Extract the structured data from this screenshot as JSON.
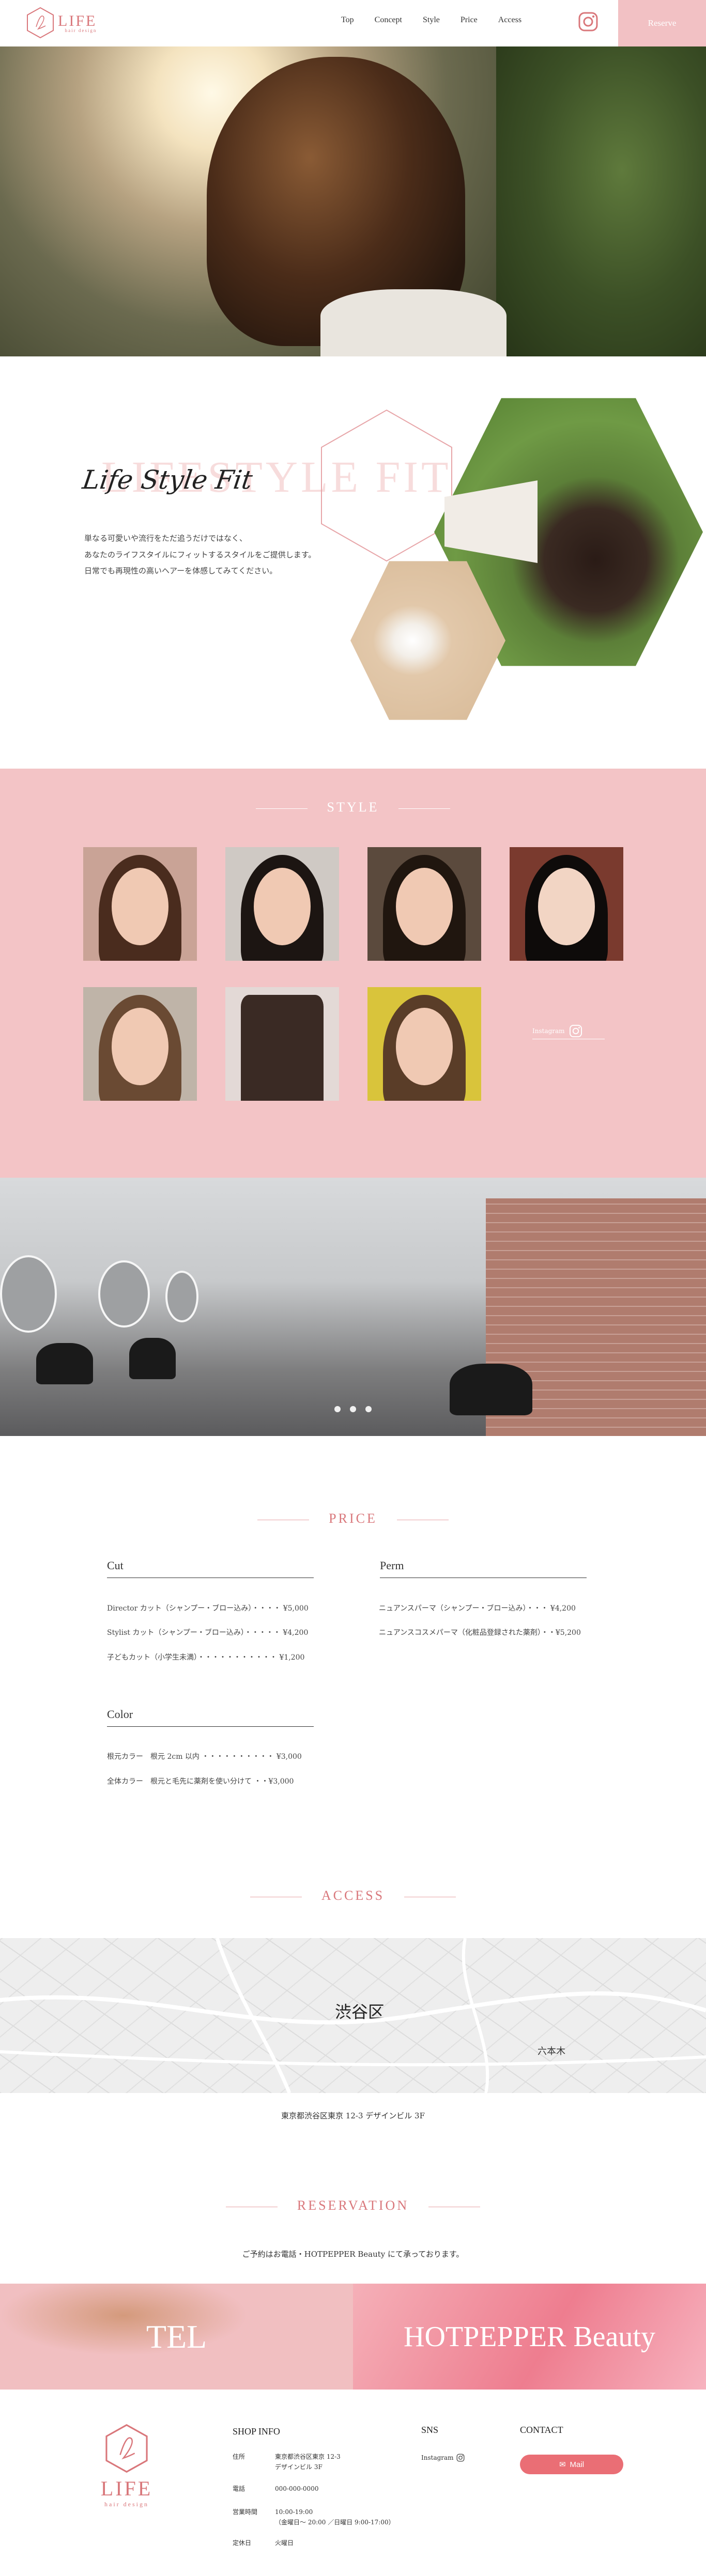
{
  "header": {
    "logo_text": "LIFE",
    "logo_sub": "hair design",
    "nav": [
      "Top",
      "Concept",
      "Style",
      "Price",
      "Access"
    ],
    "instagram_icon": "instagram-icon",
    "reserve_label": "Reserve"
  },
  "concept": {
    "bg_text": "LIFESTYLE FIT",
    "title": "Life Style Fit",
    "body": [
      "単なる可愛いや流行をただ追うだけではなく、",
      "あなたのライフスタイルにフィットするスタイルをご提供します。",
      "日常でも再現性の高いヘアーを体感してみてください。"
    ]
  },
  "style": {
    "title": "STYLE",
    "instagram_label": "Instagram"
  },
  "price": {
    "title": "PRICE",
    "categories": [
      {
        "name": "Cut",
        "rows": [
          "Director カット（シャンプー・ブロー込み）・・・・ ¥5,000",
          "Stylist カット（シャンプー・ブロー込み）・・・・・ ¥4,200",
          "子どもカット（小学生未満）・・・・・・・・・・・ ¥1,200"
        ]
      },
      {
        "name": "Perm",
        "rows": [
          "ニュアンスパーマ（シャンプー・ブロー込み）・・・ ¥4,200",
          "ニュアンスコスメパーマ（化粧品登録された薬剤）・・¥5,200"
        ]
      },
      {
        "name": "Color",
        "rows": [
          "根元カラー　根元 2cm 以内 ・・・・・・・・・・ ¥3,000",
          "全体カラー　根元と毛先に薬剤を使い分けて ・・¥3,000"
        ]
      }
    ]
  },
  "access": {
    "title": "ACCESS",
    "map_area": "渋谷区",
    "map_roppongi": "六本木",
    "address": "東京都渋谷区東京 12-3 デザインビル 3F"
  },
  "reservation": {
    "title": "RESERVATION",
    "note": "ご予約はお電話・HOTPEPPER Beauty にて承っております。",
    "tel_label": "TEL",
    "hotpepper_label": "HOTPEPPER Beauty"
  },
  "footer": {
    "logo_text": "LIFE",
    "logo_sub": "hair design",
    "shop_info_title": "SHOP INFO",
    "info": [
      {
        "k": "住所",
        "v": [
          "東京都渋谷区東京 12-3",
          "デザインビル 3F"
        ]
      },
      {
        "k": "電話",
        "v": [
          "000-000-0000"
        ]
      },
      {
        "k": "営業時間",
        "v": [
          "10:00-19:00",
          "（金曜日〜 20:00 ／日曜日 9:00-17:00）"
        ]
      },
      {
        "k": "定休日",
        "v": [
          "火曜日"
        ]
      }
    ],
    "sns_title": "SNS",
    "sns_label": "Instagram",
    "contact_title": "CONTACT",
    "mail_label": "Mail"
  },
  "colors": {
    "accent": "#d9777b",
    "pink_bg": "#f3c4c6",
    "mail": "#ea6e75"
  }
}
